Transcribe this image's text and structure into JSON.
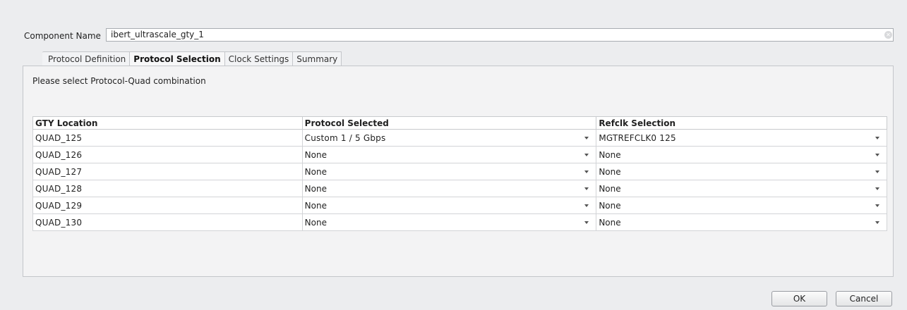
{
  "component": {
    "label": "Component Name",
    "value": "ibert_ultrascale_gty_1"
  },
  "tabs": [
    {
      "label": "Protocol Definition"
    },
    {
      "label": "Protocol Selection"
    },
    {
      "label": "Clock Settings"
    },
    {
      "label": "Summary"
    }
  ],
  "active_tab": "Protocol Selection",
  "panel": {
    "instruction": "Please select Protocol-Quad combination"
  },
  "table": {
    "headers": [
      "GTY Location",
      "Protocol Selected",
      "Refclk Selection"
    ],
    "rows": [
      {
        "location": "QUAD_125",
        "protocol": "Custom 1 / 5 Gbps",
        "refclk": "MGTREFCLK0 125"
      },
      {
        "location": "QUAD_126",
        "protocol": "None",
        "refclk": "None"
      },
      {
        "location": "QUAD_127",
        "protocol": "None",
        "refclk": "None"
      },
      {
        "location": "QUAD_128",
        "protocol": "None",
        "refclk": "None"
      },
      {
        "location": "QUAD_129",
        "protocol": "None",
        "refclk": "None"
      },
      {
        "location": "QUAD_130",
        "protocol": "None",
        "refclk": "None"
      }
    ]
  },
  "buttons": {
    "ok": "OK",
    "cancel": "Cancel"
  },
  "icons": {
    "clear": "clear-icon",
    "dropdown": "chevron-down-icon"
  }
}
